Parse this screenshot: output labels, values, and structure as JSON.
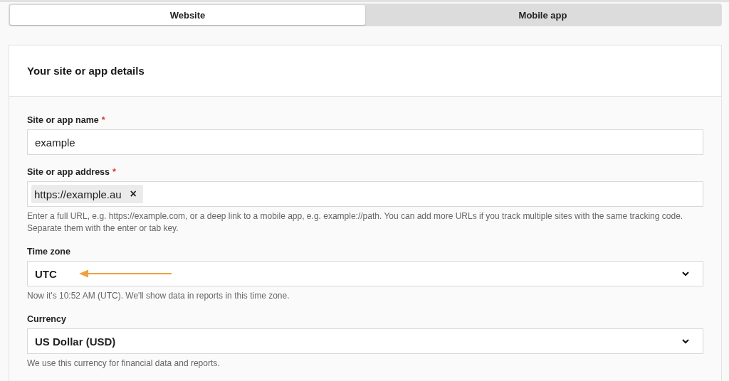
{
  "tabs": [
    {
      "label": "Website",
      "selected": true
    },
    {
      "label": "Mobile app",
      "selected": false
    }
  ],
  "card": {
    "title": "Your site or app details",
    "fields": [
      {
        "kind": "text",
        "label": "Site or app name",
        "marker": "*",
        "value": "example"
      },
      {
        "kind": "tags",
        "label": "Site or app address",
        "marker": "*",
        "tags": [
          "https://example.au"
        ],
        "remove": "×",
        "help": "Enter a full URL, e.g. https://example.com, or a deep link to a mobile app, e.g. example://path. You can add more URLs if you track multiple sites with the same tracking code. Separate them with the enter or tab key."
      },
      {
        "kind": "select",
        "label": "Time zone",
        "value": "UTC",
        "help": "Now it's 10:52 AM (UTC). We'll show data in reports in this time zone."
      },
      {
        "kind": "select",
        "label": "Currency",
        "value": "US Dollar (USD)",
        "help": "We use this currency for financial data and reports."
      }
    ]
  }
}
